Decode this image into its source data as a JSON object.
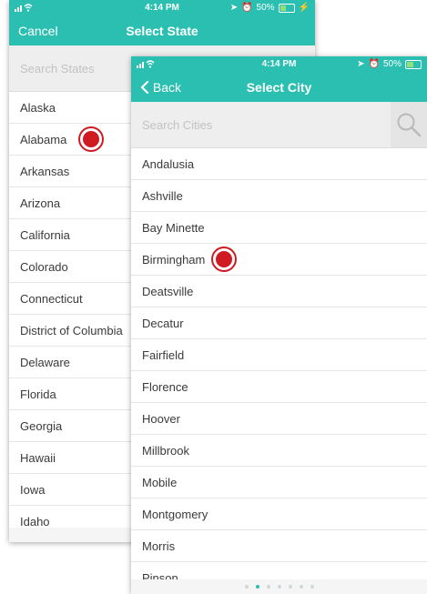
{
  "colors": {
    "accent": "#2bbfb1",
    "marker": "#d01a21"
  },
  "state_screen": {
    "status": {
      "time": "4:14 PM",
      "battery": "50%",
      "battery_level": 0.5
    },
    "nav": {
      "left_label": "Cancel",
      "title": "Select State"
    },
    "search": {
      "placeholder": "Search States"
    },
    "states": [
      "Alaska",
      "Alabama",
      "Arkansas",
      "Arizona",
      "California",
      "Colorado",
      "Connecticut",
      "District of Columbia",
      "Delaware",
      "Florida",
      "Georgia",
      "Hawaii",
      "Iowa",
      "Idaho"
    ],
    "tapped": "Alabama"
  },
  "city_screen": {
    "status": {
      "time": "4:14 PM",
      "battery": "50%",
      "battery_level": 0.5
    },
    "nav": {
      "back_label": "Back",
      "title": "Select City"
    },
    "search": {
      "placeholder": "Search Cities",
      "icon": "search-icon"
    },
    "cities": [
      "Andalusia",
      "Ashville",
      "Bay Minette",
      "Birmingham",
      "Deatsville",
      "Decatur",
      "Fairfield",
      "Florence",
      "Hoover",
      "Millbrook",
      "Mobile",
      "Montgomery",
      "Morris",
      "Pinson"
    ],
    "tapped": "Birmingham",
    "pager": {
      "count": 7,
      "active": 1
    }
  }
}
